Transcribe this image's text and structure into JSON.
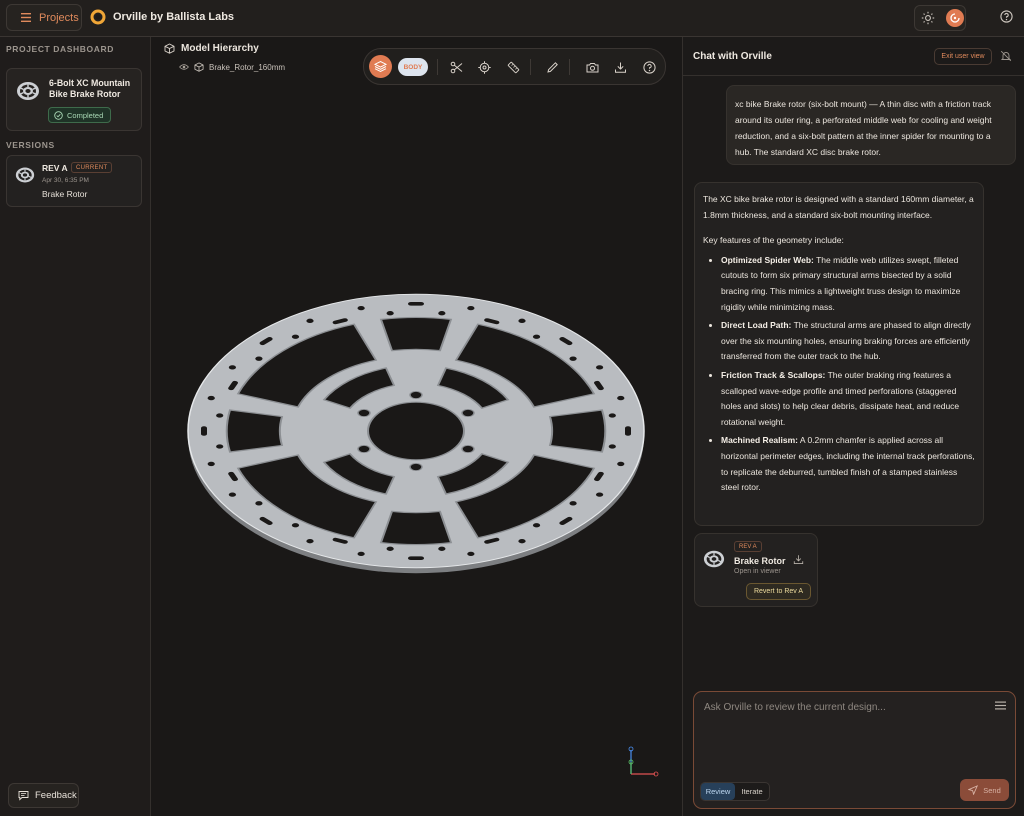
{
  "topbar": {
    "projects_label": "Projects",
    "brand_title": "Orville by Ballista Labs",
    "icons": [
      "menu-icon",
      "sun-icon",
      "avatar-icon",
      "help-icon"
    ]
  },
  "sidebar": {
    "project_dashboard_label": "PROJECT DASHBOARD",
    "project": {
      "title": "6-Bolt XC Mountain Bike Brake Rotor",
      "status": "Completed"
    },
    "versions_label": "VERSIONS",
    "version": {
      "name": "REV A",
      "badge": "CURRENT",
      "date": "Apr 30, 6:35 PM",
      "model": "Brake Rotor"
    },
    "feedback_label": "Feedback"
  },
  "viewport": {
    "hierarchy_title": "Model Hierarchy",
    "hierarchy_item": "Brake_Rotor_160mm",
    "toolbar": {
      "body_label": "BODY",
      "tools": [
        "layers-icon",
        "scissors-icon",
        "target-icon",
        "ruler-icon",
        "pencil-icon",
        "camera-icon",
        "download-icon",
        "help-icon"
      ]
    }
  },
  "chat": {
    "title": "Chat with Orville",
    "exit_label": "Exit user view",
    "user_message": "xc bike Brake rotor (six-bolt mount) — A thin disc with a friction track around its outer ring, a perforated middle web for cooling and weight reduction, and a six-bolt pattern at the inner spider for mounting to a hub. The standard XC disc brake rotor.",
    "ai_intro": "The XC bike brake rotor is designed with a standard 160mm diameter, a 1.8mm thickness, and a standard six-bolt mounting interface.",
    "ai_features_heading": "Key features of the geometry include:",
    "ai_features": [
      {
        "title": "Optimized Spider Web:",
        "text": " The middle web utilizes swept, filleted cutouts to form six primary structural arms bisected by a solid bracing ring. This mimics a lightweight truss design to maximize rigidity while minimizing mass."
      },
      {
        "title": "Direct Load Path:",
        "text": " The structural arms are phased to align directly over the six mounting holes, ensuring braking forces are efficiently transferred from the outer track to the hub."
      },
      {
        "title": "Friction Track & Scallops:",
        "text": " The outer braking ring features a scalloped wave-edge profile and timed perforations (staggered holes and slots) to help clear debris, dissipate heat, and reduce rotational weight."
      },
      {
        "title": "Machined Realism:",
        "text": " A 0.2mm chamfer is applied across all horizontal perimeter edges, including the internal track perforations, to replicate the deburred, tumbled finish of a stamped stainless steel rotor."
      }
    ],
    "revision_card": {
      "badge": "REV A",
      "name": "Brake Rotor",
      "subtitle": "Open in viewer",
      "revert_label": "Revert to Rev A"
    },
    "input": {
      "placeholder": "Ask Orville to review the current design...",
      "value": ""
    },
    "modes": [
      "Review",
      "Iterate"
    ],
    "active_mode": "Review",
    "send_label": "Send"
  },
  "colors": {
    "accent": "#e07b52",
    "background": "#1c1a19",
    "success": "#3e6b4b",
    "review_active": "#27405a"
  }
}
